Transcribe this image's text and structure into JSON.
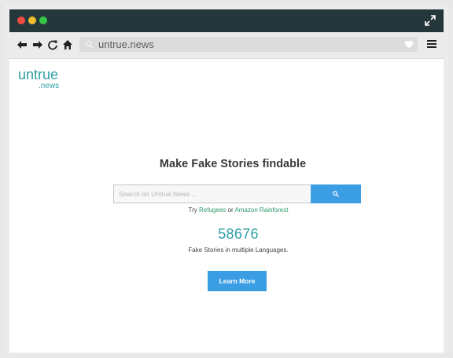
{
  "browser": {
    "url": "untrue.news",
    "icons": [
      "back-arrow-icon",
      "forward-arrow-icon",
      "reload-icon",
      "home-icon",
      "search-icon",
      "heart-icon",
      "hamburger-menu-icon",
      "expand-icon"
    ],
    "window_controls": [
      "close",
      "minimize",
      "maximize"
    ]
  },
  "logo": {
    "main": "untrue",
    "sub": ".news"
  },
  "hero": {
    "headline": "Make Fake Stories findable",
    "search_placeholder": "Search on Untrue.News ...",
    "try_prefix": "Try",
    "try_link_1": "Refugees",
    "try_or": "or",
    "try_link_2": "Amazon Rainforest",
    "count": "58676",
    "count_caption": "Fake Stories in multiple Languages.",
    "learn_more": "Learn More"
  },
  "colors": {
    "titlebar": "#24383c",
    "accent": "#3b9de3",
    "brand_teal": "#2f9fa6",
    "link_green": "#2f9a6a"
  }
}
